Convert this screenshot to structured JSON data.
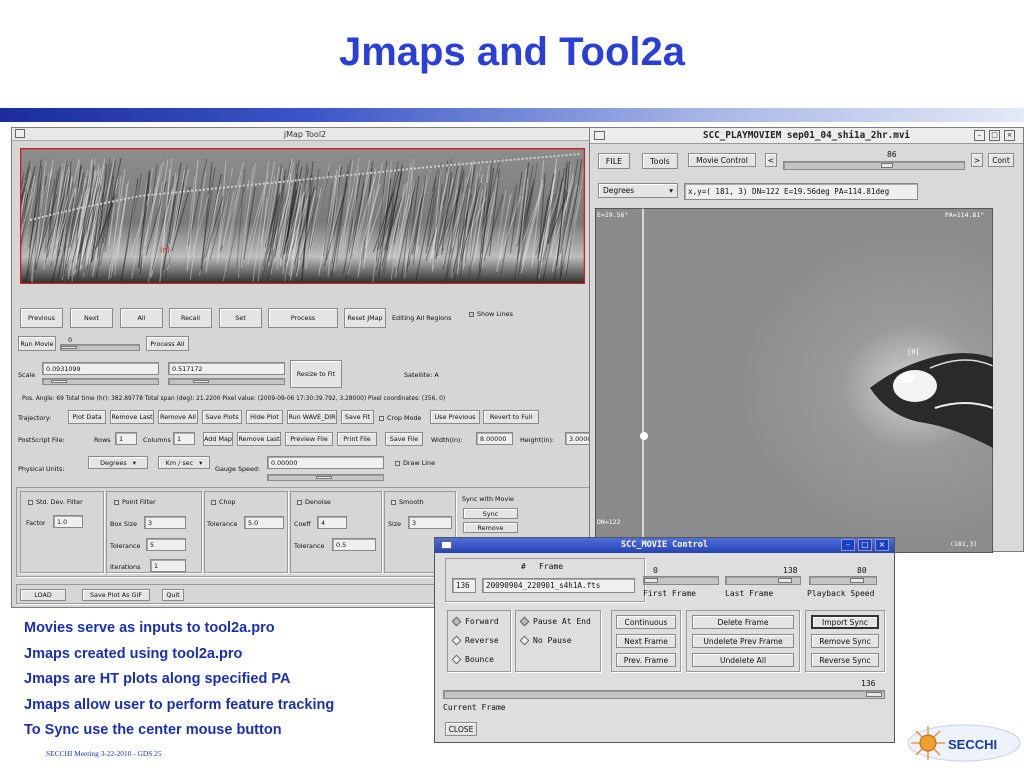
{
  "slide": {
    "title": "Jmaps and Tool2a",
    "bullets": [
      "Movies serve as inputs to tool2a.pro",
      "Jmaps created using tool2a.pro",
      "Jmaps are HT plots along specified PA",
      "Jmaps allow user to perform feature tracking",
      "To Sync use the center mouse button"
    ],
    "footer": "SECCHI Meeting  3-22-2010  - GDS 25",
    "logo_text": "SECCHI",
    "colors": {
      "title": "#2a3fd8",
      "bullets": "#1a2fb8",
      "band": "#1c2c9c"
    }
  },
  "jmap": {
    "window_title": "jMap Tool2",
    "image_marker": "(n)",
    "row1": [
      "Previous",
      "Next",
      "All",
      "Recall",
      "Set",
      "Process",
      "Reset JMap"
    ],
    "editing": "Editing All Regions",
    "show_lines": "Show Lines",
    "run_movie": "Run Movie",
    "run_movie_value": "0",
    "process_all": "Process All",
    "scale_label": "Scale",
    "scale1": "0.0931099",
    "scale2": "0.517172",
    "resize": "Resize to Fit",
    "satellite": "Satellite: A",
    "status": "Pos. Angle: 69   Total time (hr): 382.89778  Total span (deg): 21.2200   Pixel value: (2009-09-06 17:30:39.792, 3.28000)      Pixel coordinates: (356, 0)",
    "traj_label": "Trajectory:",
    "traj_buttons": [
      "Plot Data",
      "Remove Last",
      "Remove All",
      "Save Plots",
      "Hide Plot",
      "Run WAVE_DIR",
      "Save Fit"
    ],
    "crop_mode": "Crop Mode",
    "traj_buttons2": [
      "Use Previous",
      "Revert to Full"
    ],
    "ps_label": "PostScript File:",
    "rows_label": "Rows",
    "rows_val": "1",
    "cols_label": "Columns",
    "cols_val": "1",
    "ps_buttons": [
      "Add Map",
      "Remove Last",
      "Preview File",
      "Print File",
      "Save File"
    ],
    "width_label": "Width(in):",
    "width_val": "8.00000",
    "height_label": "Height(in):",
    "height_val": "3.0000",
    "phys_label": "Physical Units:",
    "units1": "Degrees",
    "units2": "Km / sec",
    "gauge_label": "Gauge Speed:",
    "gauge_val": "0.00000",
    "draw_line": "Draw Line",
    "filters": {
      "std": "Std. Dev. Filter",
      "factor_label": "Factor",
      "factor_val": "1.0",
      "point": "Point Filter",
      "box_label": "Box Size",
      "box_val": "3",
      "tol_label": "Tolerance",
      "tol_val": "5",
      "iter_label": "Iterations",
      "iter_val": "1",
      "chop": "Chop",
      "chop_tol_label": "Tolerance",
      "chop_tol_val": "5.0",
      "denoise": "Denoise",
      "coeff_label": "Coeff",
      "coeff_val": "4",
      "den_tol_label": "Tolerance",
      "den_tol_val": "0.5",
      "smooth": "Smooth",
      "size_label": "Size",
      "size_val": "3",
      "sync_movie": "Sync with Movie",
      "sync": "Sync",
      "remove": "Remove"
    },
    "bottom": [
      "LOAD",
      "Save Plot As GIF",
      "Quit"
    ]
  },
  "playmovie": {
    "window_title": "SCC_PLAYMOVIEM  sep01_04_shi1a_2hr.mvi",
    "file": "FILE",
    "tools": "Tools",
    "movie_control": "Movie Control",
    "frame_val": "86",
    "cont": "Cont",
    "units": "Degrees",
    "coords": "x,y=( 181,   3) DN=122 E=19.56deg PA=114.81deg",
    "img_e": "E=19.56°",
    "img_pa": "PA=114.81°",
    "img_marker": "[0]",
    "img_dn": "DN=122",
    "img_xy": "(181,3)"
  },
  "moviectl": {
    "window_title": "SCC_MOVIE Control",
    "col_hash": "#",
    "col_frame": "Frame",
    "frame_num": "136",
    "filename": "20090904_220901_s4h1A.fts",
    "first_val": "0",
    "last_val": "138",
    "speed_val": "80",
    "first_label": "First Frame",
    "last_label": "Last Frame",
    "speed_label": "Playback Speed",
    "dir": [
      "Forward",
      "Reverse",
      "Bounce"
    ],
    "pause": [
      "Pause At End",
      "No Pause"
    ],
    "nav": [
      "Continuous",
      "Next Frame",
      "Prev. Frame"
    ],
    "edit": [
      "Delete Frame",
      "Undelete Prev Frame",
      "Undelete All"
    ],
    "sync": [
      "Import Sync",
      "Remove Sync",
      "Reverse Sync"
    ],
    "current_val": "136",
    "current_label": "Current Frame",
    "close": "CLOSE"
  }
}
